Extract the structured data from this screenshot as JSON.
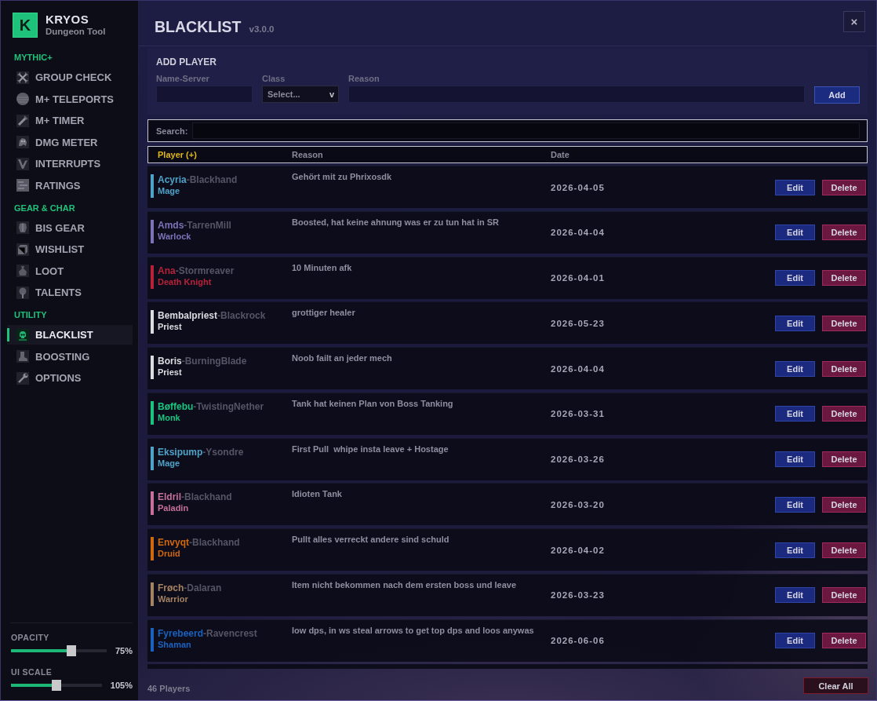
{
  "sidebar": {
    "logo": {
      "letter": "K",
      "title": "KRYOS",
      "subtitle": "Dungeon Tool"
    },
    "sections": [
      {
        "heading": "MYTHIC+",
        "items": [
          {
            "label": "GROUP CHECK",
            "selected": false
          },
          {
            "label": "M+ TELEPORTS",
            "selected": false
          },
          {
            "label": "M+ TIMER",
            "selected": false
          },
          {
            "label": "DMG METER",
            "selected": false
          },
          {
            "label": "INTERRUPTS",
            "selected": false
          },
          {
            "label": "RATINGS",
            "selected": false
          }
        ]
      },
      {
        "heading": "GEAR & CHAR",
        "items": [
          {
            "label": "BIS GEAR",
            "selected": false
          },
          {
            "label": "WISHLIST",
            "selected": false
          },
          {
            "label": "LOOT",
            "selected": false
          },
          {
            "label": "TALENTS",
            "selected": false
          }
        ]
      },
      {
        "heading": "UTILITY",
        "items": [
          {
            "label": "BLACKLIST",
            "selected": true
          },
          {
            "label": "BOOSTING",
            "selected": false
          },
          {
            "label": "OPTIONS",
            "selected": false
          }
        ]
      }
    ],
    "sliders": [
      {
        "label": "OPACITY",
        "level": 0.63,
        "reading": "75%"
      },
      {
        "label": "UI SCALE",
        "level": 0.5,
        "reading": "105%"
      }
    ]
  },
  "header": {
    "title": "BLACKLIST",
    "version": "v3.0.0",
    "close": "×"
  },
  "add_player": {
    "title": "ADD PLAYER",
    "fields": [
      {
        "kind": "text",
        "label": "Name-Server"
      },
      {
        "kind": "select",
        "label": "Class",
        "value": "Select...",
        "caret": "v"
      },
      {
        "kind": "text",
        "label": "Reason"
      }
    ],
    "button": "Add"
  },
  "search": {
    "label": "Search:"
  },
  "table": {
    "columns": [
      {
        "label": "Player (+)",
        "selected": true
      },
      {
        "label": "Reason",
        "selected": false
      },
      {
        "label": "Date",
        "selected": false
      }
    ],
    "rows": [
      {
        "name": "Acyria",
        "server": "-Blackhand",
        "class": "Mage",
        "color": "#4fa3c8",
        "reason": "Gehört mit zu Phrixosdk",
        "date": "2026-04-05",
        "edit": "Edit",
        "delete": "Delete"
      },
      {
        "name": "Amds",
        "server": "-TarrenMill",
        "class": "Warlock",
        "color": "#7d72b8",
        "reason": "Boosted, hat keine ahnung was er zu tun hat in SR",
        "date": "2026-04-04",
        "edit": "Edit",
        "delete": "Delete"
      },
      {
        "name": "Ana",
        "server": "-Stormreaver",
        "class": "Death Knight",
        "color": "#b82238",
        "reason": "10 Minuten afk",
        "date": "2026-04-01",
        "edit": "Edit",
        "delete": "Delete"
      },
      {
        "name": "Bembalpriest",
        "server": "-Blackrock",
        "class": "Priest",
        "color": "#dcdce0",
        "reason": "grottiger healer",
        "date": "2026-05-23",
        "edit": "Edit",
        "delete": "Delete"
      },
      {
        "name": "Boris",
        "server": "-BurningBlade",
        "class": "Priest",
        "color": "#dcdce0",
        "reason": "Noob failt an jeder mech",
        "date": "2026-04-04",
        "edit": "Edit",
        "delete": "Delete"
      },
      {
        "name": "Bøffebu",
        "server": "-TwistingNether",
        "class": "Monk",
        "color": "#1ac47f",
        "reason": "Tank hat keinen Plan von Boss Tanking",
        "date": "2026-03-31",
        "edit": "Edit",
        "delete": "Delete"
      },
      {
        "name": "Eksipump",
        "server": "-Ysondre",
        "class": "Mage",
        "color": "#4fa3c8",
        "reason": "First Pull  whipe insta leave + Hostage",
        "date": "2026-03-26",
        "edit": "Edit",
        "delete": "Delete"
      },
      {
        "name": "Eldril",
        "server": "-Blackhand",
        "class": "Paladin",
        "color": "#c6709a",
        "reason": "Idioten Tank",
        "date": "2026-03-20",
        "edit": "Edit",
        "delete": "Delete"
      },
      {
        "name": "Envyqt",
        "server": "-Blackhand",
        "class": "Druid",
        "color": "#d0680e",
        "reason": "Pullt alles verreckt andere sind schuld",
        "date": "2026-04-02",
        "edit": "Edit",
        "delete": "Delete"
      },
      {
        "name": "Frøch",
        "server": "-Dalaran",
        "class": "Warrior",
        "color": "#a58261",
        "reason": "Item nicht bekommen nach dem ersten boss und leave",
        "date": "2026-03-23",
        "edit": "Edit",
        "delete": "Delete"
      },
      {
        "name": "Fyrebeerd",
        "server": "-Ravencrest",
        "class": "Shaman",
        "color": "#1a62be",
        "reason": "low dps, in ws steal arrows to get top dps and loos anywas",
        "date": "2026-06-06",
        "edit": "Edit",
        "delete": "Delete"
      }
    ]
  },
  "footer": {
    "count": "46 Players",
    "button": "Clear All"
  }
}
